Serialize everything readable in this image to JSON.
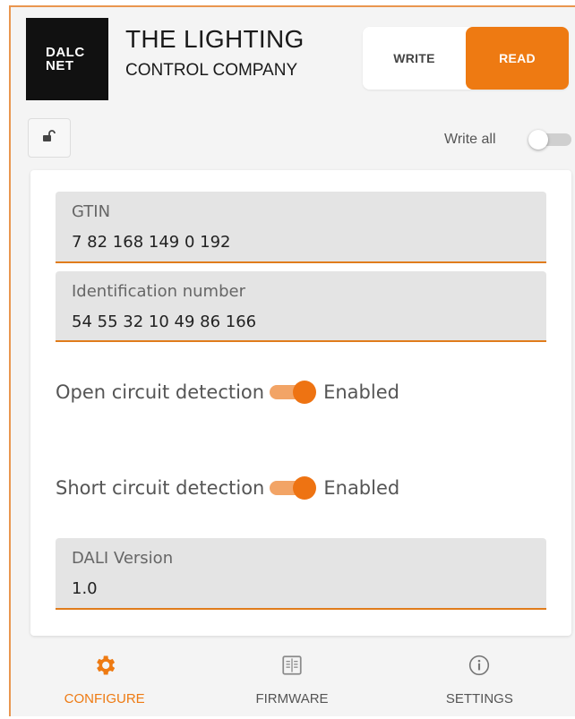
{
  "header": {
    "logo": {
      "line1": "DALC",
      "line2": "NET"
    },
    "company": {
      "line1": "THE LIGHTING",
      "line2": "CONTROL COMPANY"
    },
    "mode": {
      "write_label": "WRITE",
      "read_label": "READ",
      "selected": "READ"
    }
  },
  "toolbar": {
    "lock_icon": "unlock-icon",
    "write_all_label": "Write all",
    "write_all_on": false
  },
  "fields": {
    "gtin": {
      "label": "GTIN",
      "value": "7 82 168 149 0 192"
    },
    "ident": {
      "label": "Identification number",
      "value": "54 55 32 10 49 86 166"
    },
    "dali": {
      "label": "DALI Version",
      "value": "1.0"
    }
  },
  "toggles": {
    "open_circuit": {
      "label": "Open circuit detection",
      "state": "Enabled",
      "on": true
    },
    "short_circuit": {
      "label": "Short circuit detection",
      "state": "Enabled",
      "on": true
    }
  },
  "nav": {
    "configure": {
      "label": "CONFIGURE",
      "icon": "gear-icon",
      "active": true
    },
    "firmware": {
      "label": "FIRMWARE",
      "icon": "firmware-icon",
      "active": false
    },
    "settings": {
      "label": "SETTINGS",
      "icon": "info-icon",
      "active": false
    }
  },
  "colors": {
    "accent": "#ee7a12",
    "field_bg": "#e4e4e4"
  }
}
